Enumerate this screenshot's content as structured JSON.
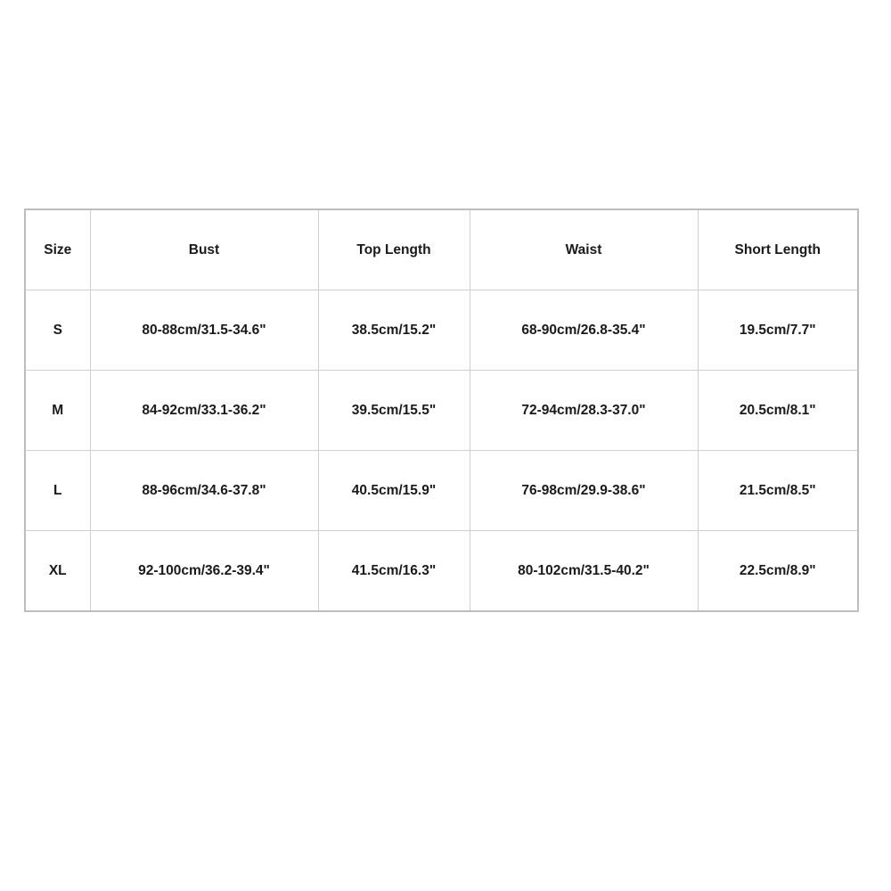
{
  "table": {
    "headers": [
      "Size",
      "Bust",
      "Top Length",
      "Waist",
      "Short Length"
    ],
    "rows": [
      [
        "S",
        "80-88cm/31.5-34.6\"",
        "38.5cm/15.2\"",
        "68-90cm/26.8-35.4\"",
        "19.5cm/7.7\""
      ],
      [
        "M",
        "84-92cm/33.1-36.2\"",
        "39.5cm/15.5\"",
        "72-94cm/28.3-37.0\"",
        "20.5cm/8.1\""
      ],
      [
        "L",
        "88-96cm/34.6-37.8\"",
        "40.5cm/15.9\"",
        "76-98cm/29.9-38.6\"",
        "21.5cm/8.5\""
      ],
      [
        "XL",
        "92-100cm/36.2-39.4\"",
        "41.5cm/16.3\"",
        "80-102cm/31.5-40.2\"",
        "22.5cm/8.9\""
      ]
    ]
  }
}
